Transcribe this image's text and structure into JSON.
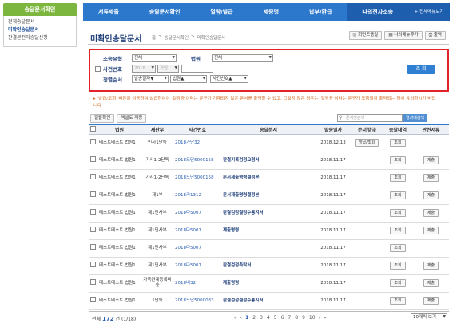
{
  "sidebar": {
    "title": "송달문서확인",
    "items": [
      "전체송달문서",
      "미확인송달문서",
      "판결본전자송달신청"
    ]
  },
  "topnav": {
    "items": [
      "서류제출",
      "송달문서확인",
      "열람/발급",
      "제증명",
      "납부/환급",
      "나의전자소송"
    ],
    "all_label": "+ 전체메뉴보기"
  },
  "page": {
    "title": "미확인송달문서",
    "breadcrumb": [
      "홈",
      ">",
      "송달문서확인",
      ">",
      "미확인송달문서"
    ],
    "tools": [
      "회면도움말",
      "나의메뉴추가",
      "출력"
    ]
  },
  "search": {
    "case_type_label": "소송유형",
    "case_type_value": "전체",
    "court_label": "법원",
    "court_value": "전체",
    "case_no_label": "사건번호",
    "year_value": "2018",
    "case_kind_value": "가단",
    "sort_label": "정렬순서",
    "sort_values": [
      "발송일자▼",
      "법원▲",
      "사건번호▲"
    ],
    "button_label": "조 회"
  },
  "notice": "발급/조회' 버튼을 이용하여 발급하여야 '열람중'이라는 문구가 기재되지 않은 문서를 출력할 수 있고, 그렇지 않은 경우는 '열람용'이라는 문구가 포함되어 출력되는 점에 유의하시기 바랍니다",
  "buttons": {
    "batch_check": "일괄확인",
    "excel_save": "엑셀로 저장"
  },
  "quick_search": {
    "placeholder": "문서명검색",
    "button": "결과내검색"
  },
  "table": {
    "headers": [
      "법원",
      "재판부",
      "사건번호",
      "송달문서",
      "발송일자",
      "문서발급",
      "송달내역",
      "관련서류"
    ],
    "rows": [
      [
        "테스트테스트 법원1",
        "민사1단독",
        "2018가단32",
        "",
        "2018.12.13",
        "발급/조회",
        "조회",
        ""
      ],
      [
        "테스트테스트 법원1",
        "가사1-2단독",
        "2018드단5000158",
        "판결기록검정요청서",
        "2018.11.17",
        "",
        "조회",
        "제출"
      ],
      [
        "테스트테스트 법원1",
        "가사1-2단독",
        "2018드단5000158",
        "문서제출명령결정본",
        "2018.11.17",
        "",
        "조회",
        "제출"
      ],
      [
        "테스트테스트 법원1",
        "제1부",
        "2018카1312",
        "문서제출명령결정본",
        "2018.11.17",
        "",
        "조회",
        "제출"
      ],
      [
        "테스트테스트 법원1",
        "제1민사부",
        "2018다5007",
        "판결검정결정수통지서",
        "2018.11.17",
        "",
        "조회",
        "제출"
      ],
      [
        "테스트테스트 법원1",
        "제1민사부",
        "2018다5007",
        "제출명령",
        "2018.11.17",
        "",
        "조회",
        "제출"
      ],
      [
        "테스트테스트 법원1",
        "제1민사부",
        "2018다5007",
        "",
        "2018.11.17",
        "",
        "조회",
        ""
      ],
      [
        "테스트테스트 법원1",
        "제1민사부",
        "2018다5007",
        "판결검정촉탁서",
        "2018.11.17",
        "",
        "조회",
        "제출"
      ],
      [
        "테스트테스트 법원1",
        "가족관계등록비송",
        "2018비32",
        "제출명령",
        "2018.11.17",
        "",
        "조회",
        "제출"
      ],
      [
        "테스트테스트 법원1",
        "1단독",
        "2018드단5000033",
        "판결검정결정수통지서",
        "2018.11.17",
        "",
        "조회",
        "제출"
      ]
    ]
  },
  "footer": {
    "total_prefix": "전체",
    "total_count": "172",
    "total_suffix": "건 (1/18)",
    "pages": [
      "1",
      "2",
      "3",
      "4",
      "5",
      "6",
      "7",
      "8",
      "9",
      "10"
    ],
    "per_page": "10개씩 보기"
  }
}
